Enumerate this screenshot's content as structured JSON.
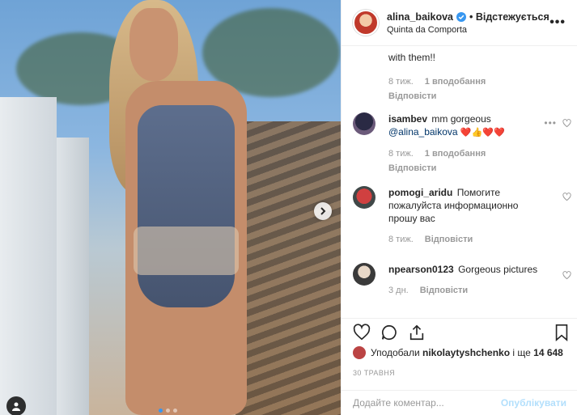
{
  "header": {
    "username": "alina_baikova",
    "follow_label": "• Відстежується",
    "location": "Quinta da Comporta",
    "more_icon": "more-dots-icon"
  },
  "comments": [
    {
      "text": "with them!!",
      "time": "8 тиж.",
      "likes": "1 вподобання",
      "reply": "Відповісти"
    },
    {
      "user": "isambev",
      "text": "mm gorgeous",
      "mention": "@alina_baikova",
      "emoji": "❤️👍❤️❤️",
      "time": "8 тиж.",
      "likes": "1 вподобання",
      "reply": "Відповісти"
    },
    {
      "user": "pomogi_aridu",
      "text": "Помогите пожалуйста информационно прошу вас",
      "time": "8 тиж.",
      "reply": "Відповісти"
    },
    {
      "user": "npearson0123",
      "text": "Gorgeous pictures",
      "time": "3 дн.",
      "reply": "Відповісти"
    }
  ],
  "likes": {
    "prefix": "Уподобали",
    "user": "nikolaytyshchenko",
    "middle": "і ще",
    "count": "14 648"
  },
  "date": "30 ТРАВНЯ",
  "add_comment": {
    "placeholder": "Додайте коментар...",
    "post_label": "Опублікувати"
  },
  "colors": {
    "accent": "#3897f0",
    "post_disabled": "#b2dffc",
    "heart": "#ed4956"
  }
}
